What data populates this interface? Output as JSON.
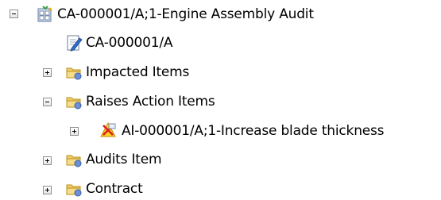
{
  "tree": {
    "root": {
      "label": "CA-000001/A;1-Engine Assembly Audit",
      "icon": "change-object-icon",
      "expanded": true,
      "children": [
        {
          "label": "CA-000001/A",
          "icon": "revision-edit-icon",
          "expandable": false
        },
        {
          "label": "Impacted Items",
          "icon": "folder-icon",
          "expandable": true,
          "expanded": false
        },
        {
          "label": "Raises Action Items",
          "icon": "folder-icon",
          "expandable": true,
          "expanded": true,
          "children": [
            {
              "label": "AI-000001/A;1-Increase blade thickness",
              "icon": "action-item-icon",
              "expandable": true,
              "expanded": false
            }
          ]
        },
        {
          "label": "Audits Item",
          "icon": "folder-icon",
          "expandable": true,
          "expanded": false
        },
        {
          "label": "Contract",
          "icon": "folder-icon",
          "expandable": true,
          "expanded": false
        }
      ]
    }
  }
}
